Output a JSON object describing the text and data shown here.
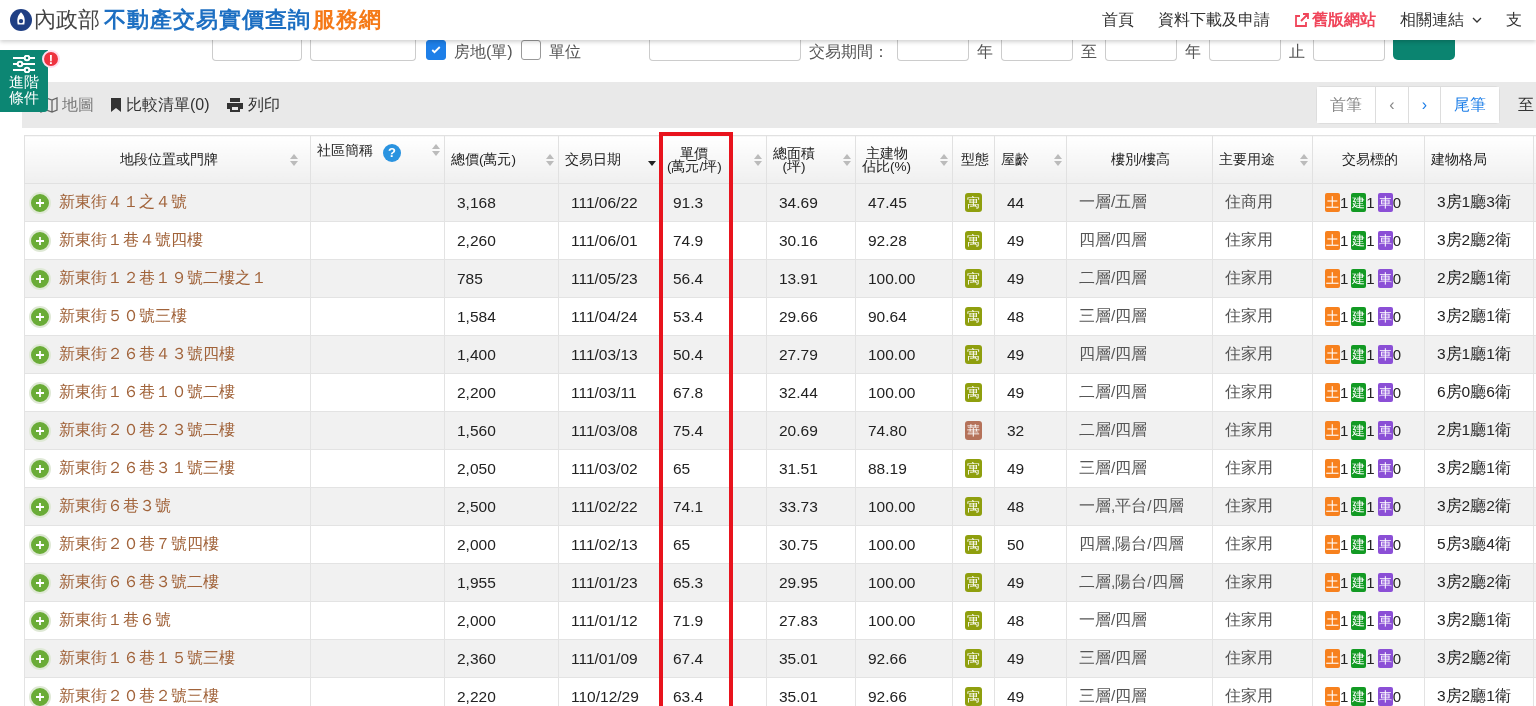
{
  "header": {
    "logo_org": "內政部",
    "logo_title": "不動產交易實價查詢",
    "logo_suffix": "服務網",
    "nav": [
      {
        "label": "首頁",
        "kind": "link"
      },
      {
        "label": "資料下載及申請",
        "kind": "link"
      },
      {
        "label": "舊版網站",
        "kind": "external"
      },
      {
        "label": "相關連結",
        "kind": "dropdown"
      },
      {
        "label": "支",
        "kind": "link"
      }
    ]
  },
  "filter": {
    "checks": [
      {
        "label": "房地(單)",
        "checked": true
      },
      {
        "label": "單位",
        "checked": false
      }
    ],
    "labels": [
      "交易期間：",
      "年",
      "至",
      "年",
      "止"
    ]
  },
  "advanced": {
    "label": "進階條件",
    "alert": "!"
  },
  "toolbar": {
    "actions": [
      {
        "label": "地圖",
        "kind": "map"
      },
      {
        "label": "比較清單(0)",
        "kind": "bookmark"
      },
      {
        "label": "列印",
        "kind": "print"
      }
    ],
    "pager": [
      {
        "label": "首筆",
        "disabled": true
      },
      {
        "label": "‹",
        "disabled": true
      },
      {
        "label": "›",
        "disabled": false
      },
      {
        "label": "尾筆",
        "disabled": false
      }
    ],
    "goto": "至"
  },
  "table": {
    "columns": [
      {
        "label": [
          "地段位置或門牌"
        ],
        "sorted": false,
        "highlighted": false
      },
      {
        "label": [
          "社區簡稱"
        ],
        "sorted": false,
        "help": "?",
        "highlighted": false
      },
      {
        "label": [
          "總價(萬元)"
        ],
        "sorted": false,
        "highlighted": false
      },
      {
        "label": [
          "交易日期"
        ],
        "sorted": true,
        "highlighted": false
      },
      {
        "label": [
          "單價",
          "(萬元/坪)"
        ],
        "sorted": false,
        "highlighted": true
      },
      {
        "label": [
          "總面積",
          "(坪)"
        ],
        "sorted": false,
        "highlighted": false
      },
      {
        "label": [
          "主建物",
          "佔比(%)"
        ],
        "sorted": false,
        "highlighted": false
      },
      {
        "label": [
          "型態"
        ],
        "highlighted": false
      },
      {
        "label": [
          "屋齡"
        ],
        "sorted": false,
        "highlighted": false
      },
      {
        "label": [
          "樓別/樓高"
        ],
        "highlighted": false
      },
      {
        "label": [
          "主要用途"
        ],
        "sorted": false,
        "highlighted": false
      },
      {
        "label": [
          "交易標的"
        ],
        "highlighted": false
      },
      {
        "label": [
          "建物格局"
        ],
        "highlighted": false
      }
    ],
    "rows": [
      {
        "address": "新東街４１之４號",
        "community": "",
        "total": "3,168",
        "date": "111/06/22",
        "unit": "91.3",
        "area": "34.69",
        "ratio": "47.45",
        "type": {
          "label": "寓",
          "color": "#8f9f0e"
        },
        "age": "44",
        "floor": "一層/五層",
        "use": "住商用",
        "deal": [
          "土",
          "1",
          "建",
          "1",
          "車",
          "0"
        ],
        "layout": "3房1廳3衛"
      },
      {
        "address": "新東街１巷４號四樓",
        "community": "",
        "total": "2,260",
        "date": "111/06/01",
        "unit": "74.9",
        "area": "30.16",
        "ratio": "92.28",
        "type": {
          "label": "寓",
          "color": "#8f9f0e"
        },
        "age": "49",
        "floor": "四層/四層",
        "use": "住家用",
        "deal": [
          "土",
          "1",
          "建",
          "1",
          "車",
          "0"
        ],
        "layout": "3房2廳2衛"
      },
      {
        "address": "新東街１２巷１９號二樓之１",
        "community": "",
        "total": "785",
        "date": "111/05/23",
        "unit": "56.4",
        "area": "13.91",
        "ratio": "100.00",
        "type": {
          "label": "寓",
          "color": "#8f9f0e"
        },
        "age": "49",
        "floor": "二層/四層",
        "use": "住家用",
        "deal": [
          "土",
          "1",
          "建",
          "1",
          "車",
          "0"
        ],
        "layout": "2房2廳1衛"
      },
      {
        "address": "新東街５０號三樓",
        "community": "",
        "total": "1,584",
        "date": "111/04/24",
        "unit": "53.4",
        "area": "29.66",
        "ratio": "90.64",
        "type": {
          "label": "寓",
          "color": "#8f9f0e"
        },
        "age": "48",
        "floor": "三層/四層",
        "use": "住家用",
        "deal": [
          "土",
          "1",
          "建",
          "1",
          "車",
          "0"
        ],
        "layout": "3房2廳1衛"
      },
      {
        "address": "新東街２６巷４３號四樓",
        "community": "",
        "total": "1,400",
        "date": "111/03/13",
        "unit": "50.4",
        "area": "27.79",
        "ratio": "100.00",
        "type": {
          "label": "寓",
          "color": "#8f9f0e"
        },
        "age": "49",
        "floor": "四層/四層",
        "use": "住家用",
        "deal": [
          "土",
          "1",
          "建",
          "1",
          "車",
          "0"
        ],
        "layout": "3房1廳1衛"
      },
      {
        "address": "新東街１６巷１０號二樓",
        "community": "",
        "total": "2,200",
        "date": "111/03/11",
        "unit": "67.8",
        "area": "32.44",
        "ratio": "100.00",
        "type": {
          "label": "寓",
          "color": "#8f9f0e"
        },
        "age": "49",
        "floor": "二層/四層",
        "use": "住家用",
        "deal": [
          "土",
          "1",
          "建",
          "1",
          "車",
          "0"
        ],
        "layout": "6房0廳6衛"
      },
      {
        "address": "新東街２０巷２３號二樓",
        "community": "",
        "total": "1,560",
        "date": "111/03/08",
        "unit": "75.4",
        "area": "20.69",
        "ratio": "74.80",
        "type": {
          "label": "華",
          "color": "#b5725a"
        },
        "age": "32",
        "floor": "二層/四層",
        "use": "住家用",
        "deal": [
          "土",
          "1",
          "建",
          "1",
          "車",
          "0"
        ],
        "layout": "2房1廳1衛"
      },
      {
        "address": "新東街２６巷３１號三樓",
        "community": "",
        "total": "2,050",
        "date": "111/03/02",
        "unit": "65",
        "area": "31.51",
        "ratio": "88.19",
        "type": {
          "label": "寓",
          "color": "#8f9f0e"
        },
        "age": "49",
        "floor": "三層/四層",
        "use": "住家用",
        "deal": [
          "土",
          "1",
          "建",
          "1",
          "車",
          "0"
        ],
        "layout": "3房2廳1衛"
      },
      {
        "address": "新東街６巷３號",
        "community": "",
        "total": "2,500",
        "date": "111/02/22",
        "unit": "74.1",
        "area": "33.73",
        "ratio": "100.00",
        "type": {
          "label": "寓",
          "color": "#8f9f0e"
        },
        "age": "48",
        "floor": "一層,平台/四層",
        "use": "住家用",
        "deal": [
          "土",
          "1",
          "建",
          "1",
          "車",
          "0"
        ],
        "layout": "3房2廳2衛"
      },
      {
        "address": "新東街２０巷７號四樓",
        "community": "",
        "total": "2,000",
        "date": "111/02/13",
        "unit": "65",
        "area": "30.75",
        "ratio": "100.00",
        "type": {
          "label": "寓",
          "color": "#8f9f0e"
        },
        "age": "50",
        "floor": "四層,陽台/四層",
        "use": "住家用",
        "deal": [
          "土",
          "1",
          "建",
          "1",
          "車",
          "0"
        ],
        "layout": "5房3廳4衛"
      },
      {
        "address": "新東街６６巷３號二樓",
        "community": "",
        "total": "1,955",
        "date": "111/01/23",
        "unit": "65.3",
        "area": "29.95",
        "ratio": "100.00",
        "type": {
          "label": "寓",
          "color": "#8f9f0e"
        },
        "age": "49",
        "floor": "二層,陽台/四層",
        "use": "住家用",
        "deal": [
          "土",
          "1",
          "建",
          "1",
          "車",
          "0"
        ],
        "layout": "3房2廳2衛"
      },
      {
        "address": "新東街１巷６號",
        "community": "",
        "total": "2,000",
        "date": "111/01/12",
        "unit": "71.9",
        "area": "27.83",
        "ratio": "100.00",
        "type": {
          "label": "寓",
          "color": "#8f9f0e"
        },
        "age": "48",
        "floor": "一層/四層",
        "use": "住家用",
        "deal": [
          "土",
          "1",
          "建",
          "1",
          "車",
          "0"
        ],
        "layout": "3房2廳1衛"
      },
      {
        "address": "新東街１６巷１５號三樓",
        "community": "",
        "total": "2,360",
        "date": "111/01/09",
        "unit": "67.4",
        "area": "35.01",
        "ratio": "92.66",
        "type": {
          "label": "寓",
          "color": "#8f9f0e"
        },
        "age": "49",
        "floor": "三層/四層",
        "use": "住家用",
        "deal": [
          "土",
          "1",
          "建",
          "1",
          "車",
          "0"
        ],
        "layout": "3房2廳2衛"
      },
      {
        "address": "新東街２０巷２號三樓",
        "community": "",
        "total": "2,220",
        "date": "110/12/29",
        "unit": "63.4",
        "area": "35.01",
        "ratio": "92.66",
        "type": {
          "label": "寓",
          "color": "#8f9f0e"
        },
        "age": "49",
        "floor": "三層/四層",
        "use": "住家用",
        "deal": [
          "土",
          "1",
          "建",
          "1",
          "車",
          "0"
        ],
        "layout": "3房2廳1衛"
      }
    ]
  }
}
